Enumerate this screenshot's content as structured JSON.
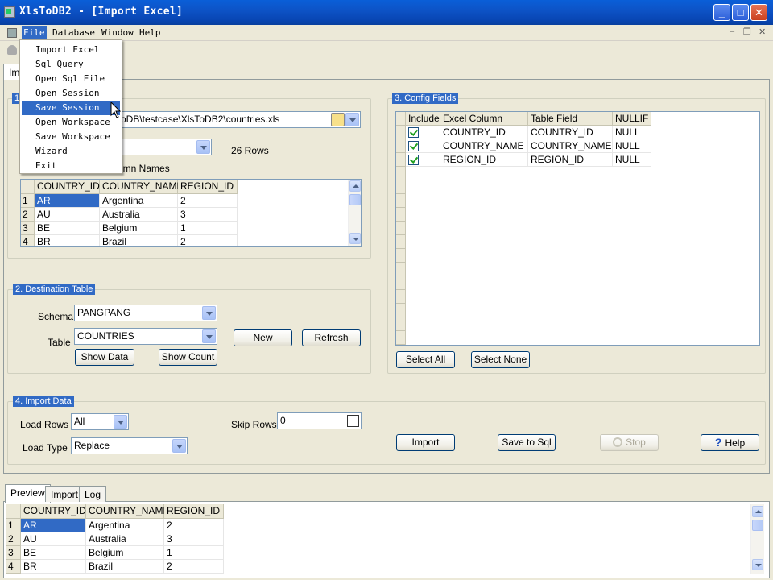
{
  "window": {
    "title": "XlsToDB2 - [Import Excel]",
    "min": "_",
    "max": "□",
    "close": "✕"
  },
  "menubar": {
    "file": "File",
    "database": "Database",
    "window": "Window",
    "help": "Help",
    "mdi_min": "–",
    "mdi_restore": "❐",
    "mdi_close": "✕"
  },
  "main_tab": "Im",
  "file_menu": [
    "Import Excel",
    "Sql Query",
    "Open Sql File",
    "Open Session",
    "Save Session",
    "Open Workspace",
    "Save Workspace",
    "Wizard",
    "Exit"
  ],
  "source": {
    "legend": "1",
    "path": "ToDB\\testcase\\XlsToDB2\\countries.xls",
    "rows_label": "26 Rows",
    "first_row_label": "umn Names",
    "grid": {
      "headers": [
        "COUNTRY_ID",
        "COUNTRY_NAME",
        "REGION_ID"
      ],
      "rows": [
        [
          "1",
          "AR",
          "Argentina",
          "2"
        ],
        [
          "2",
          "AU",
          "Australia",
          "3"
        ],
        [
          "3",
          "BE",
          "Belgium",
          "1"
        ],
        [
          "4",
          "BR",
          "Brazil",
          "2"
        ]
      ]
    }
  },
  "destination": {
    "legend": "2. Destination Table",
    "schema_label": "Schema",
    "schema_value": "PANGPANG",
    "table_label": "Table",
    "table_value": "COUNTRIES",
    "new": "New",
    "refresh": "Refresh",
    "show_data": "Show Data",
    "show_count": "Show Count"
  },
  "config": {
    "legend": "3. Config Fields",
    "headers": [
      "Include",
      "Excel Column",
      "Table Field",
      "NULLIF"
    ],
    "rows": [
      [
        "COUNTRY_ID",
        "COUNTRY_ID",
        "NULL"
      ],
      [
        "COUNTRY_NAME",
        "COUNTRY_NAME",
        "NULL"
      ],
      [
        "REGION_ID",
        "REGION_ID",
        "NULL"
      ]
    ],
    "select_all": "Select All",
    "select_none": "Select None"
  },
  "import": {
    "legend": "4. Import Data",
    "load_rows_label": "Load Rows",
    "load_rows_value": "All",
    "load_type_label": "Load Type",
    "load_type_value": "Replace",
    "skip_rows_label": "Skip Rows",
    "skip_rows_value": "0",
    "import": "Import",
    "save_to_sql": "Save to Sql",
    "stop": "Stop",
    "help": "Help"
  },
  "bottom_tabs": [
    "Preview",
    "Import",
    "Log"
  ],
  "preview": {
    "headers": [
      "COUNTRY_ID",
      "COUNTRY_NAME",
      "REGION_ID"
    ],
    "rows": [
      [
        "1",
        "AR",
        "Argentina",
        "2"
      ],
      [
        "2",
        "AU",
        "Australia",
        "3"
      ],
      [
        "3",
        "BE",
        "Belgium",
        "1"
      ],
      [
        "4",
        "BR",
        "Brazil",
        "2"
      ]
    ]
  }
}
